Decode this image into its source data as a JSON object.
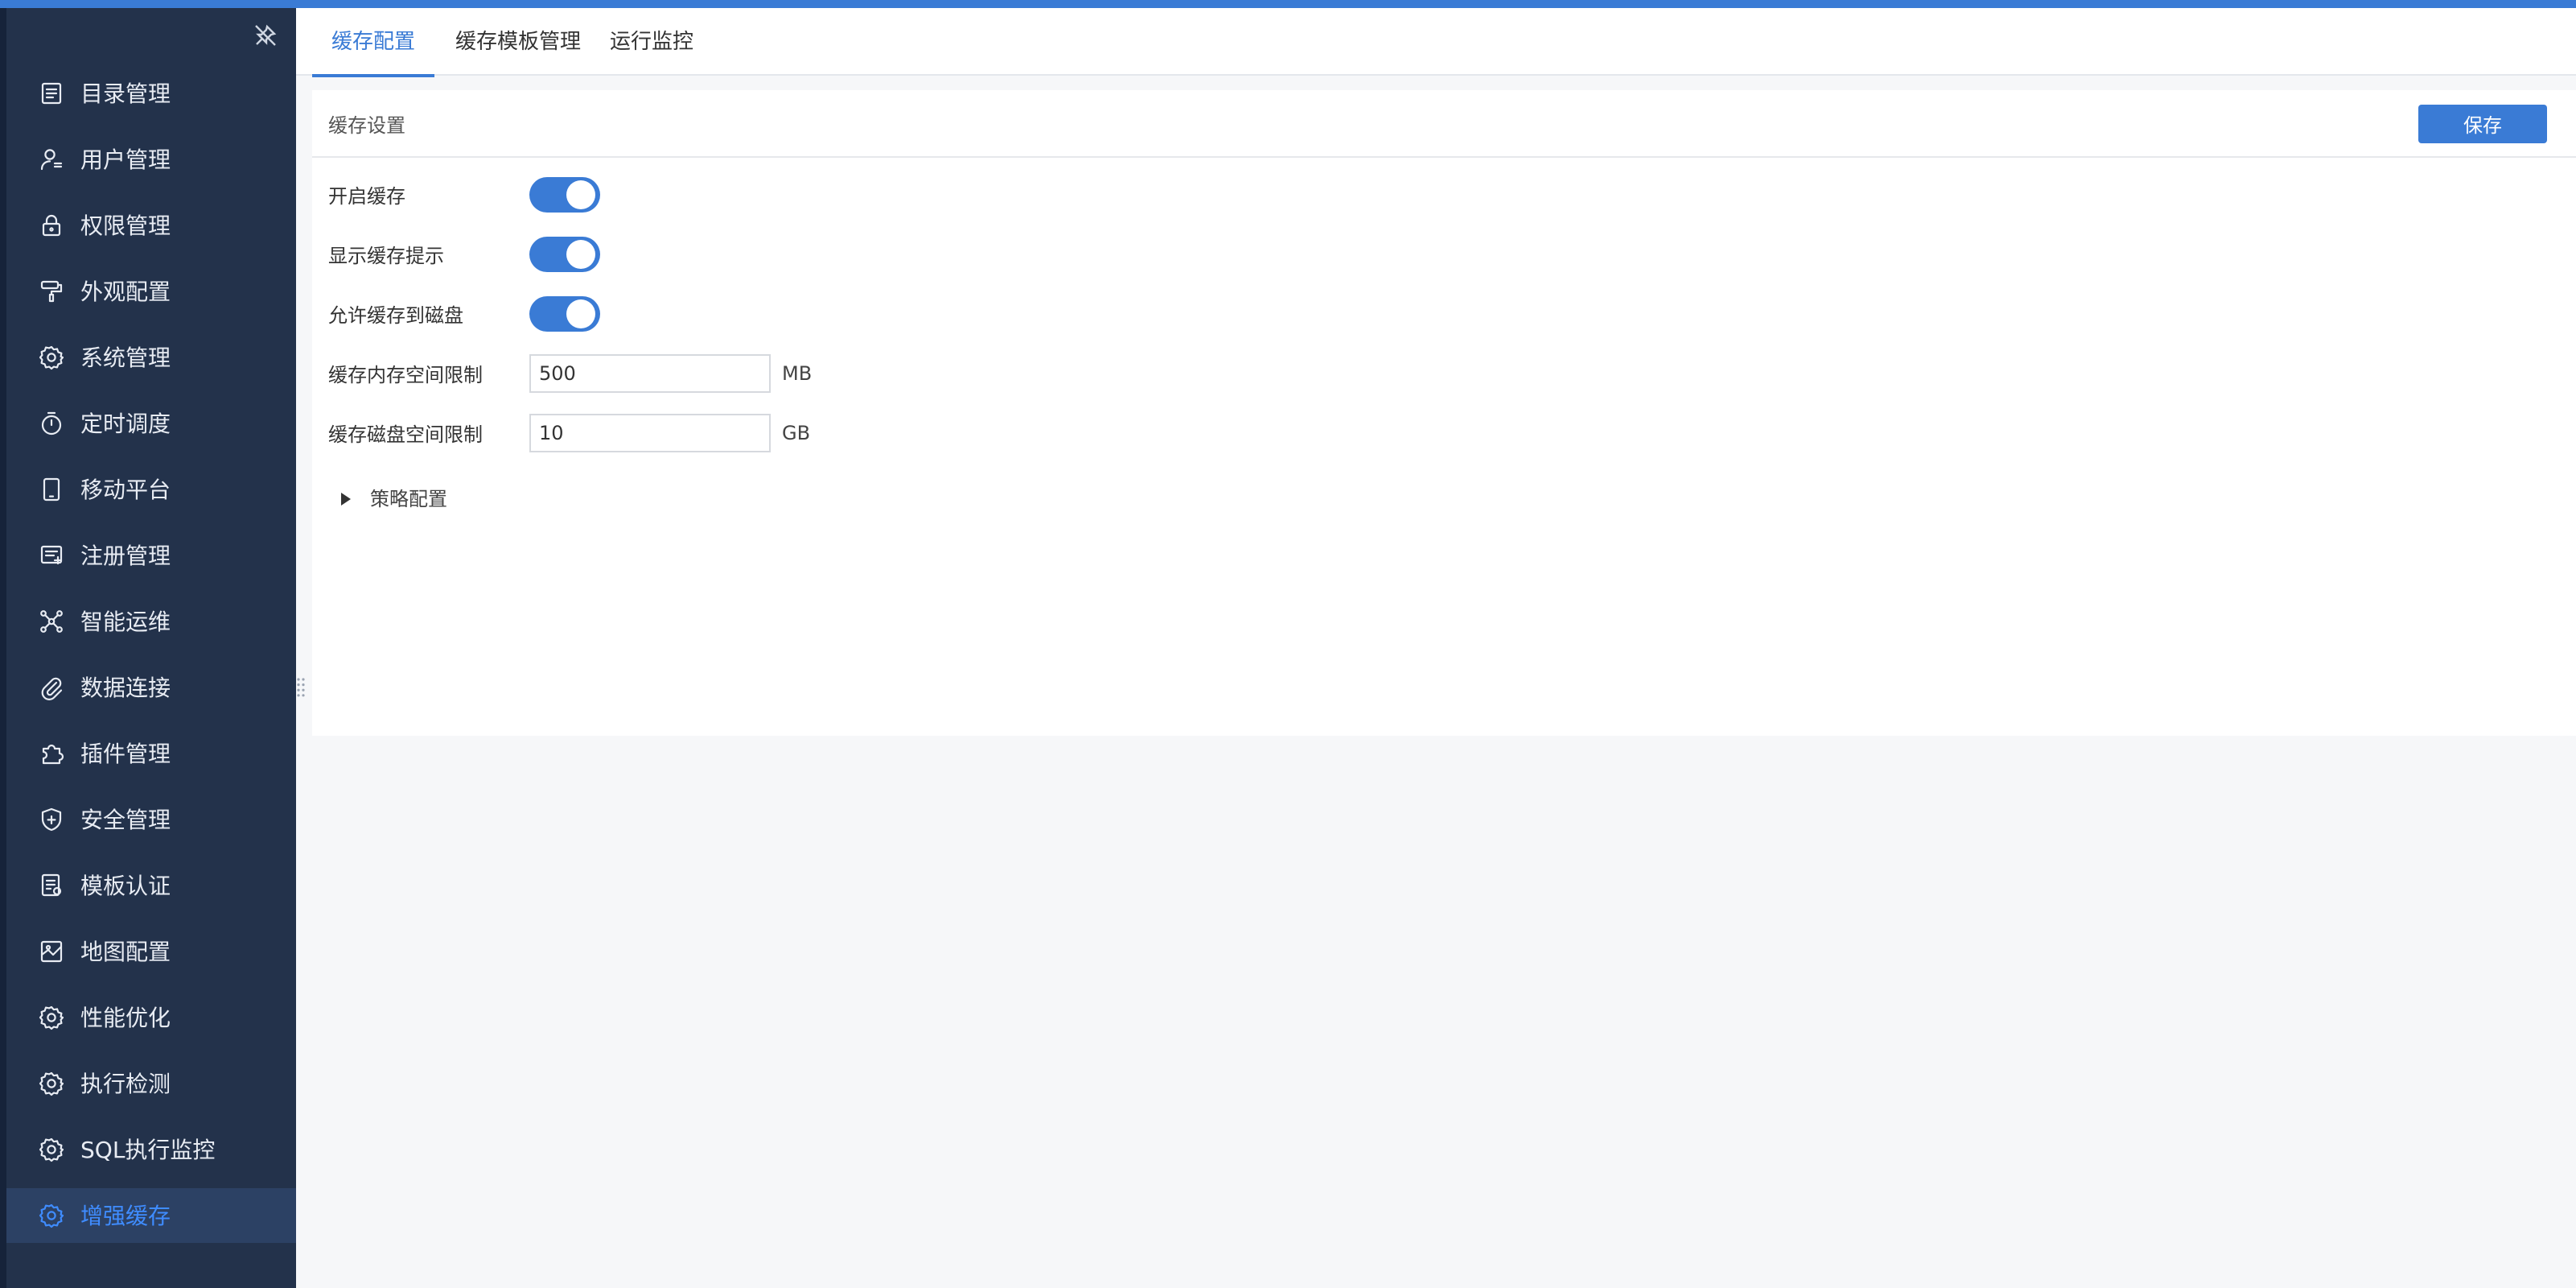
{
  "sidebar": {
    "items": [
      {
        "label": "目录管理",
        "icon": "catalog-icon"
      },
      {
        "label": "用户管理",
        "icon": "user-icon"
      },
      {
        "label": "权限管理",
        "icon": "lock-icon"
      },
      {
        "label": "外观配置",
        "icon": "paint-roller-icon"
      },
      {
        "label": "系统管理",
        "icon": "gear-icon"
      },
      {
        "label": "定时调度",
        "icon": "timer-icon"
      },
      {
        "label": "移动平台",
        "icon": "mobile-icon"
      },
      {
        "label": "注册管理",
        "icon": "register-icon"
      },
      {
        "label": "智能运维",
        "icon": "network-icon"
      },
      {
        "label": "数据连接",
        "icon": "paperclip-icon"
      },
      {
        "label": "插件管理",
        "icon": "puzzle-icon"
      },
      {
        "label": "安全管理",
        "icon": "shield-icon"
      },
      {
        "label": "模板认证",
        "icon": "template-cert-icon"
      },
      {
        "label": "地图配置",
        "icon": "map-icon"
      },
      {
        "label": "性能优化",
        "icon": "gear-icon"
      },
      {
        "label": "执行检测",
        "icon": "gear-icon"
      },
      {
        "label": "SQL执行监控",
        "icon": "gear-icon"
      },
      {
        "label": "增强缓存",
        "icon": "gear-icon",
        "active": true
      }
    ]
  },
  "tabs": [
    {
      "label": "缓存配置",
      "active": true
    },
    {
      "label": "缓存模板管理"
    },
    {
      "label": "运行监控"
    }
  ],
  "panel": {
    "title": "缓存设置",
    "save_label": "保存",
    "toggles": [
      {
        "label": "开启缓存",
        "on": true
      },
      {
        "label": "显示缓存提示",
        "on": true
      },
      {
        "label": "允许缓存到磁盘",
        "on": true
      }
    ],
    "memory_limit": {
      "label": "缓存内存空间限制",
      "value": "500",
      "unit": "MB"
    },
    "disk_limit": {
      "label": "缓存磁盘空间限制",
      "value": "10",
      "unit": "GB"
    },
    "strategy_label": "策略配置"
  },
  "colors": {
    "accent": "#3a7bd5",
    "sidebar_bg": "#23324b",
    "sidebar_active_bg": "#2c4164"
  }
}
